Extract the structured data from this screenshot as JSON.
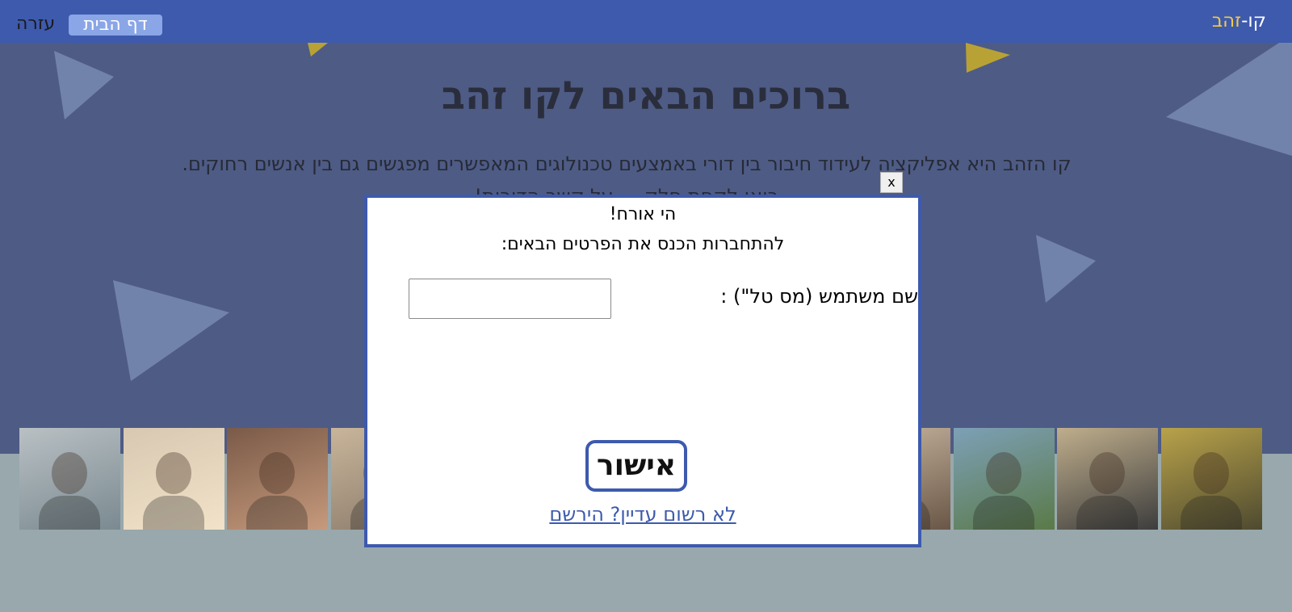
{
  "nav": {
    "brand_prefix": "קו-",
    "brand_gold": "זהב",
    "home_label": "דף הבית",
    "help_label": "עזרה"
  },
  "hero": {
    "title": "ברוכים הבאים לקו זהב",
    "line1": "קו הזהב היא אפליקציה לעידוד חיבור בין דורי באמצעים טכנולוגים המאפשרים מפגשים גם בין אנשים רחוקים.",
    "line2": "בואו לקחת חלק ... על קשר הדורות!"
  },
  "photos": {
    "count": 12,
    "palettes": [
      [
        "#b9c0c4",
        "#7a8a90"
      ],
      [
        "#d8c8b2",
        "#f1e2c8"
      ],
      [
        "#7a5a48",
        "#c69a7c"
      ],
      [
        "#c8b59a",
        "#8a7a6a"
      ],
      [
        "#b6a98c",
        "#6d604d"
      ],
      [
        "#cfc6b2",
        "#9a8e7a"
      ],
      [
        "#a89070",
        "#5a4a38"
      ],
      [
        "#b3a58a",
        "#7c6a58"
      ],
      [
        "#c9b8a2",
        "#6a5646"
      ],
      [
        "#7da0b7",
        "#5a7a48"
      ],
      [
        "#bfae8c",
        "#3d3d3d"
      ],
      [
        "#b8a24a",
        "#4e4a30"
      ]
    ]
  },
  "modal": {
    "close_label": "x",
    "greeting": "הי אורח!",
    "instructions": "להתחברות הכנס את הפרטים הבאים:",
    "username_label": "שם משתמש (מס טל\") :",
    "username_value": "",
    "username_placeholder": "",
    "confirm_label": "אישור",
    "register_link": "לא רשום עדיין? הירשם"
  },
  "colors": {
    "navbar": "#3d5aad",
    "hero_bg": "#4e5b85",
    "page_bg": "#98a8ac",
    "accent_gold": "#f3c94a",
    "triangle_light": "#7283ab",
    "triangle_gold": "#b9a235"
  }
}
